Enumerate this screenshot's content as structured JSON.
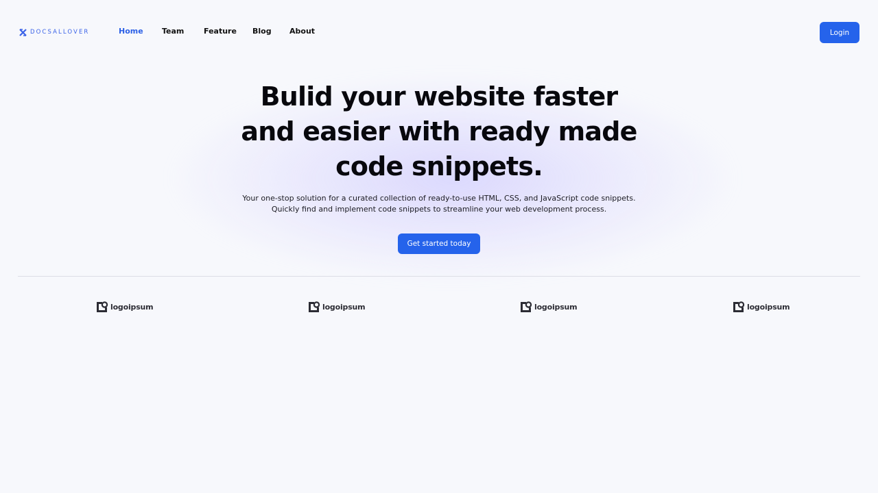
{
  "nav": {
    "brand": "DOCSALLOVER",
    "items": [
      {
        "label": "Home",
        "active": true
      },
      {
        "label": "Team",
        "active": false
      },
      {
        "label": "Feature",
        "active": false
      },
      {
        "label": "Blog",
        "active": false
      },
      {
        "label": "About",
        "active": false
      }
    ],
    "login_label": "Login"
  },
  "hero": {
    "title_lines": [
      "Bulid your website faster",
      "and easier with ready made",
      "code snippets."
    ],
    "subtitle_lines": [
      "Your one-stop solution for a curated collection of ready-to-use HTML, CSS, and JavaScript code snippets.",
      "Quickly find and implement code snippets to streamline your web development process."
    ],
    "cta_label": "Get started today"
  },
  "partners": [
    "logoipsum",
    "logoipsum",
    "logoipsum",
    "logoipsum"
  ],
  "colors": {
    "accent": "#2563eb",
    "background": "#f7f8fc",
    "glow": "#c4beff"
  }
}
